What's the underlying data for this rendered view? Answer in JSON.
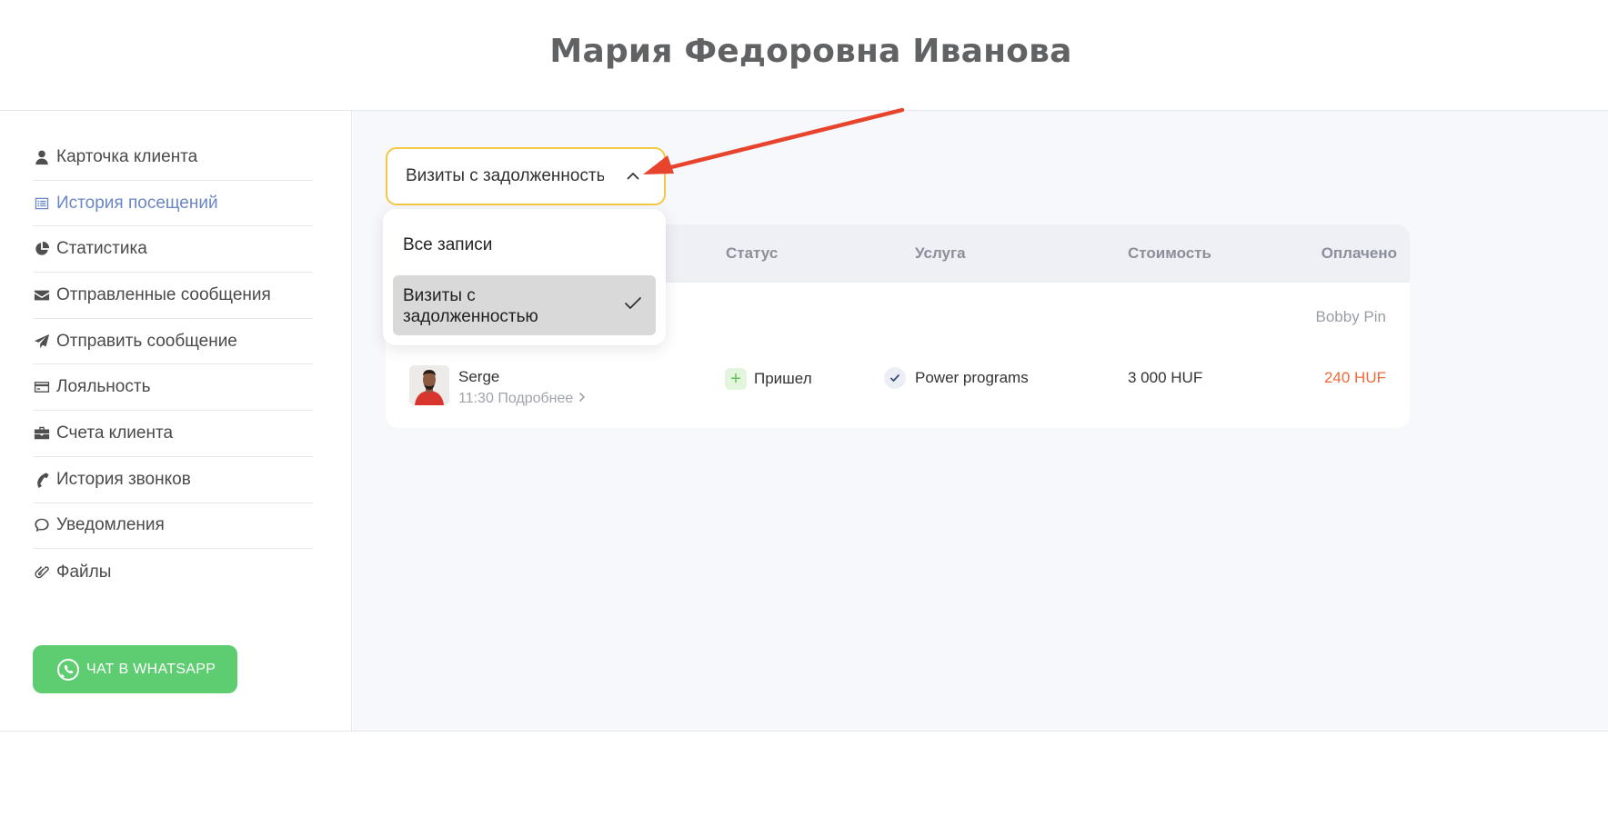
{
  "header": {
    "title": "Мария Федоровна Иванова"
  },
  "sidebar": {
    "items": [
      {
        "label": "Карточка клиента",
        "icon": "user-icon",
        "active": false
      },
      {
        "label": "История посещений",
        "icon": "list-icon",
        "active": true
      },
      {
        "label": "Статистика",
        "icon": "pie-chart-icon",
        "active": false
      },
      {
        "label": "Отправленные сообщения",
        "icon": "envelope-icon",
        "active": false
      },
      {
        "label": "Отправить сообщение",
        "icon": "paper-plane-icon",
        "active": false
      },
      {
        "label": "Лояльность",
        "icon": "credit-card-icon",
        "active": false
      },
      {
        "label": "Счета клиента",
        "icon": "briefcase-icon",
        "active": false
      },
      {
        "label": "История звонков",
        "icon": "phone-icon",
        "active": false
      },
      {
        "label": "Уведомления",
        "icon": "chat-bubble-icon",
        "active": false
      },
      {
        "label": "Файлы",
        "icon": "paperclip-icon",
        "active": false
      }
    ],
    "whatsapp_label": "ЧАТ В WHATSAPP"
  },
  "filter": {
    "selected_value": "Визиты с задолженностью",
    "options": [
      {
        "label": "Все записи",
        "selected": false
      },
      {
        "label": "Визиты с задолженностью",
        "selected": true
      }
    ]
  },
  "table": {
    "columns": {
      "status": "Статус",
      "service": "Услуга",
      "cost": "Стоимость",
      "paid": "Оплачено"
    },
    "master": "Bobby Pin",
    "rows": [
      {
        "client": "Serge",
        "time": "11:30",
        "details_label": "Подробнее",
        "status": "Пришел",
        "service": "Power programs",
        "cost": "3 000 HUF",
        "paid": "240 HUF"
      }
    ]
  },
  "colors": {
    "accent_blue": "#6a87c4",
    "select_border": "#f4c842",
    "whatsapp_green": "#5ecd71",
    "paid_orange": "#f06a3a",
    "annotation_arrow": "#e8432c"
  }
}
